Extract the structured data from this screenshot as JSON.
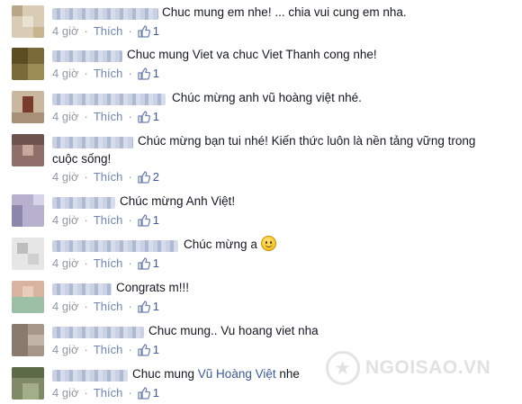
{
  "comments": [
    {
      "text_parts": [
        "Chuc mung em nhe! ... chia vui cung em nha."
      ],
      "time": "4 giờ",
      "like_label": "Thích",
      "like_count": "1"
    },
    {
      "text_parts": [
        "Chuc mung Viet va chuc Viet Thanh cong nhe!"
      ],
      "time": "4 giờ",
      "like_label": "Thích",
      "like_count": "1"
    },
    {
      "text_parts": [
        "Chúc mừng anh vũ hoàng việt nhé."
      ],
      "time": "4 giờ",
      "like_label": "Thích",
      "like_count": "1"
    },
    {
      "text_parts": [
        "Chúc mừng bạn tui nhé! Kiến thức luôn là nền tảng vững trong",
        "cuộc sống!"
      ],
      "time": "4 giờ",
      "like_label": "Thích",
      "like_count": "2"
    },
    {
      "text_parts": [
        "Chúc mừng Anh Việt!"
      ],
      "time": "4 giờ",
      "like_label": "Thích",
      "like_count": "1"
    },
    {
      "text_parts": [
        "Chúc mừng a"
      ],
      "emoji": "smiley-emoji",
      "time": "4 giờ",
      "like_label": "Thích",
      "like_count": "1"
    },
    {
      "text_parts": [
        "Congrats m!!!"
      ],
      "time": "4 giờ",
      "like_label": "Thích",
      "like_count": "1"
    },
    {
      "text_parts": [
        "Chuc mung.. Vu hoang viet nha"
      ],
      "time": "4 giờ",
      "like_label": "Thích",
      "like_count": "1"
    },
    {
      "text_parts": [
        "Chuc mung "
      ],
      "link_text": "Vũ Hoàng Việt",
      "text_after": " nhe",
      "time": "4 giờ",
      "like_label": "Thích",
      "like_count": "1"
    }
  ],
  "watermark": {
    "text": "NGOISAO.VN"
  },
  "colors": {
    "link": "#3b5998",
    "meta": "#9197a3",
    "like": "#6d84b4",
    "text": "#141823"
  }
}
